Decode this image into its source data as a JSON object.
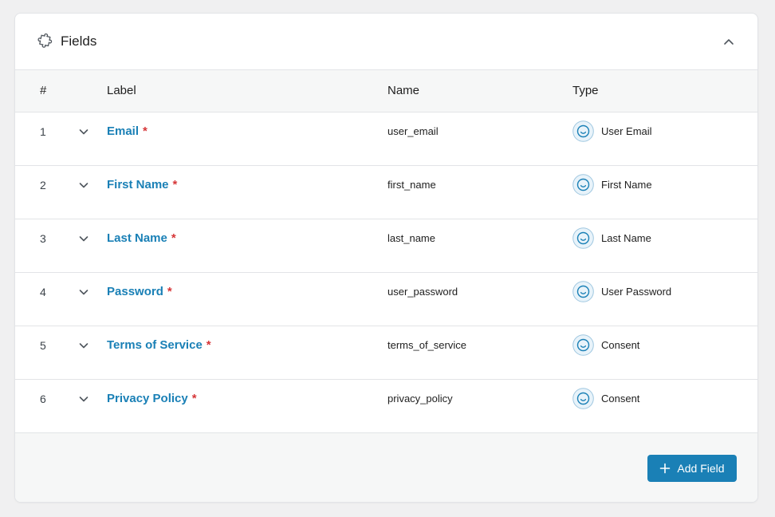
{
  "header": {
    "title": "Fields",
    "icon": "puzzle-icon",
    "collapse_icon": "chevron-up-icon"
  },
  "table": {
    "columns": {
      "number": "#",
      "label": "Label",
      "name": "Name",
      "type": "Type"
    },
    "rows": [
      {
        "number": "1",
        "label": "Email",
        "required": "*",
        "name": "user_email",
        "type": "User Email"
      },
      {
        "number": "2",
        "label": "First Name",
        "required": "*",
        "name": "first_name",
        "type": "First Name"
      },
      {
        "number": "3",
        "label": "Last Name",
        "required": "*",
        "name": "last_name",
        "type": "Last Name"
      },
      {
        "number": "4",
        "label": "Password",
        "required": "*",
        "name": "user_password",
        "type": "User Password"
      },
      {
        "number": "5",
        "label": "Terms of Service",
        "required": "*",
        "name": "terms_of_service",
        "type": "Consent"
      },
      {
        "number": "6",
        "label": "Privacy Policy",
        "required": "*",
        "name": "privacy_policy",
        "type": "Consent"
      }
    ]
  },
  "footer": {
    "add_label": "Add Field"
  },
  "colors": {
    "accent": "#1a80b6",
    "required": "#d63638",
    "header_bg": "#f6f7f7",
    "page_bg": "#f0f0f1"
  }
}
